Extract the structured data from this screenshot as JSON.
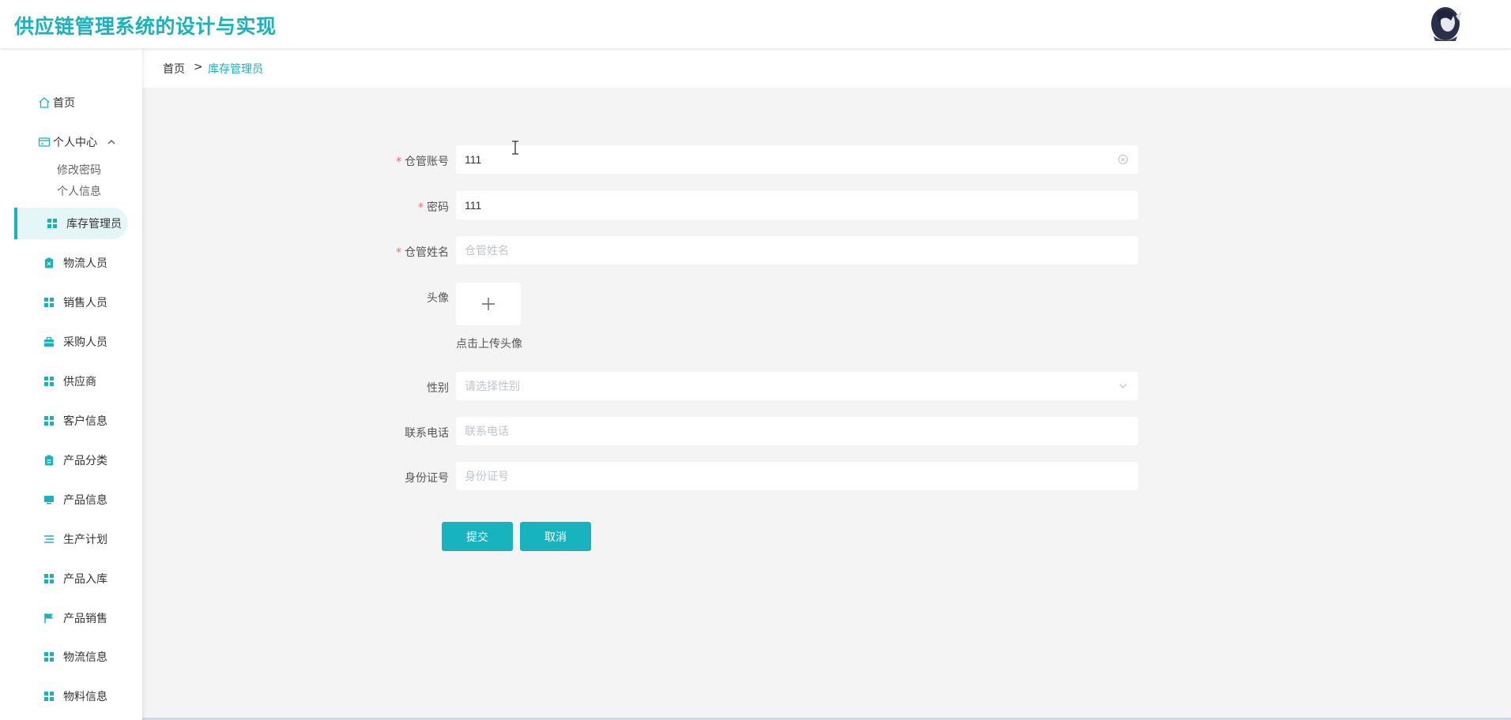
{
  "header": {
    "title": "供应链管理系统的设计与实现",
    "avatar_icon": "user-avatar"
  },
  "sidebar": {
    "home": {
      "label": "首页",
      "icon": "home-icon"
    },
    "personal_center": {
      "label": "个人中心",
      "icon": "card-icon",
      "expanded": true,
      "children": [
        {
          "label": "修改密码"
        },
        {
          "label": "个人信息"
        }
      ]
    },
    "items": [
      {
        "label": "库存管理员",
        "icon": "grid-icon",
        "active": true
      },
      {
        "label": "物流人员",
        "icon": "clipboard-x-icon"
      },
      {
        "label": "销售人员",
        "icon": "grid-icon"
      },
      {
        "label": "采购人员",
        "icon": "briefcase-icon"
      },
      {
        "label": "供应商",
        "icon": "grid-icon"
      },
      {
        "label": "客户信息",
        "icon": "grid-icon"
      },
      {
        "label": "产品分类",
        "icon": "clipboard-icon"
      },
      {
        "label": "产品信息",
        "icon": "monitor-icon"
      },
      {
        "label": "生产计划",
        "icon": "list-icon"
      },
      {
        "label": "产品入库",
        "icon": "grid-icon"
      },
      {
        "label": "产品销售",
        "icon": "flag-icon"
      },
      {
        "label": "物流信息",
        "icon": "grid-icon"
      },
      {
        "label": "物料信息",
        "icon": "grid-icon"
      }
    ]
  },
  "breadcrumb": {
    "home": "首页",
    "separator": ">",
    "current": "库存管理员"
  },
  "form": {
    "account": {
      "label": "仓管账号",
      "required": true,
      "value": "111"
    },
    "password": {
      "label": "密码",
      "required": true,
      "value": "111"
    },
    "name": {
      "label": "仓管姓名",
      "required": true,
      "value": "",
      "placeholder": "仓管姓名"
    },
    "avatar": {
      "label": "头像",
      "hint": "点击上传头像",
      "plus": "+"
    },
    "gender": {
      "label": "性别",
      "value": "",
      "placeholder": "请选择性别"
    },
    "phone": {
      "label": "联系电话",
      "value": "",
      "placeholder": "联系电话"
    },
    "id_number": {
      "label": "身份证号",
      "value": "",
      "placeholder": "身份证号"
    },
    "required_mark": "*"
  },
  "buttons": {
    "submit": "提交",
    "cancel": "取消"
  },
  "colors": {
    "accent": "#17b3bf",
    "active_bg": "#e5f6f7",
    "required": "#f56c6c",
    "page_bg": "#f4f4f5"
  }
}
